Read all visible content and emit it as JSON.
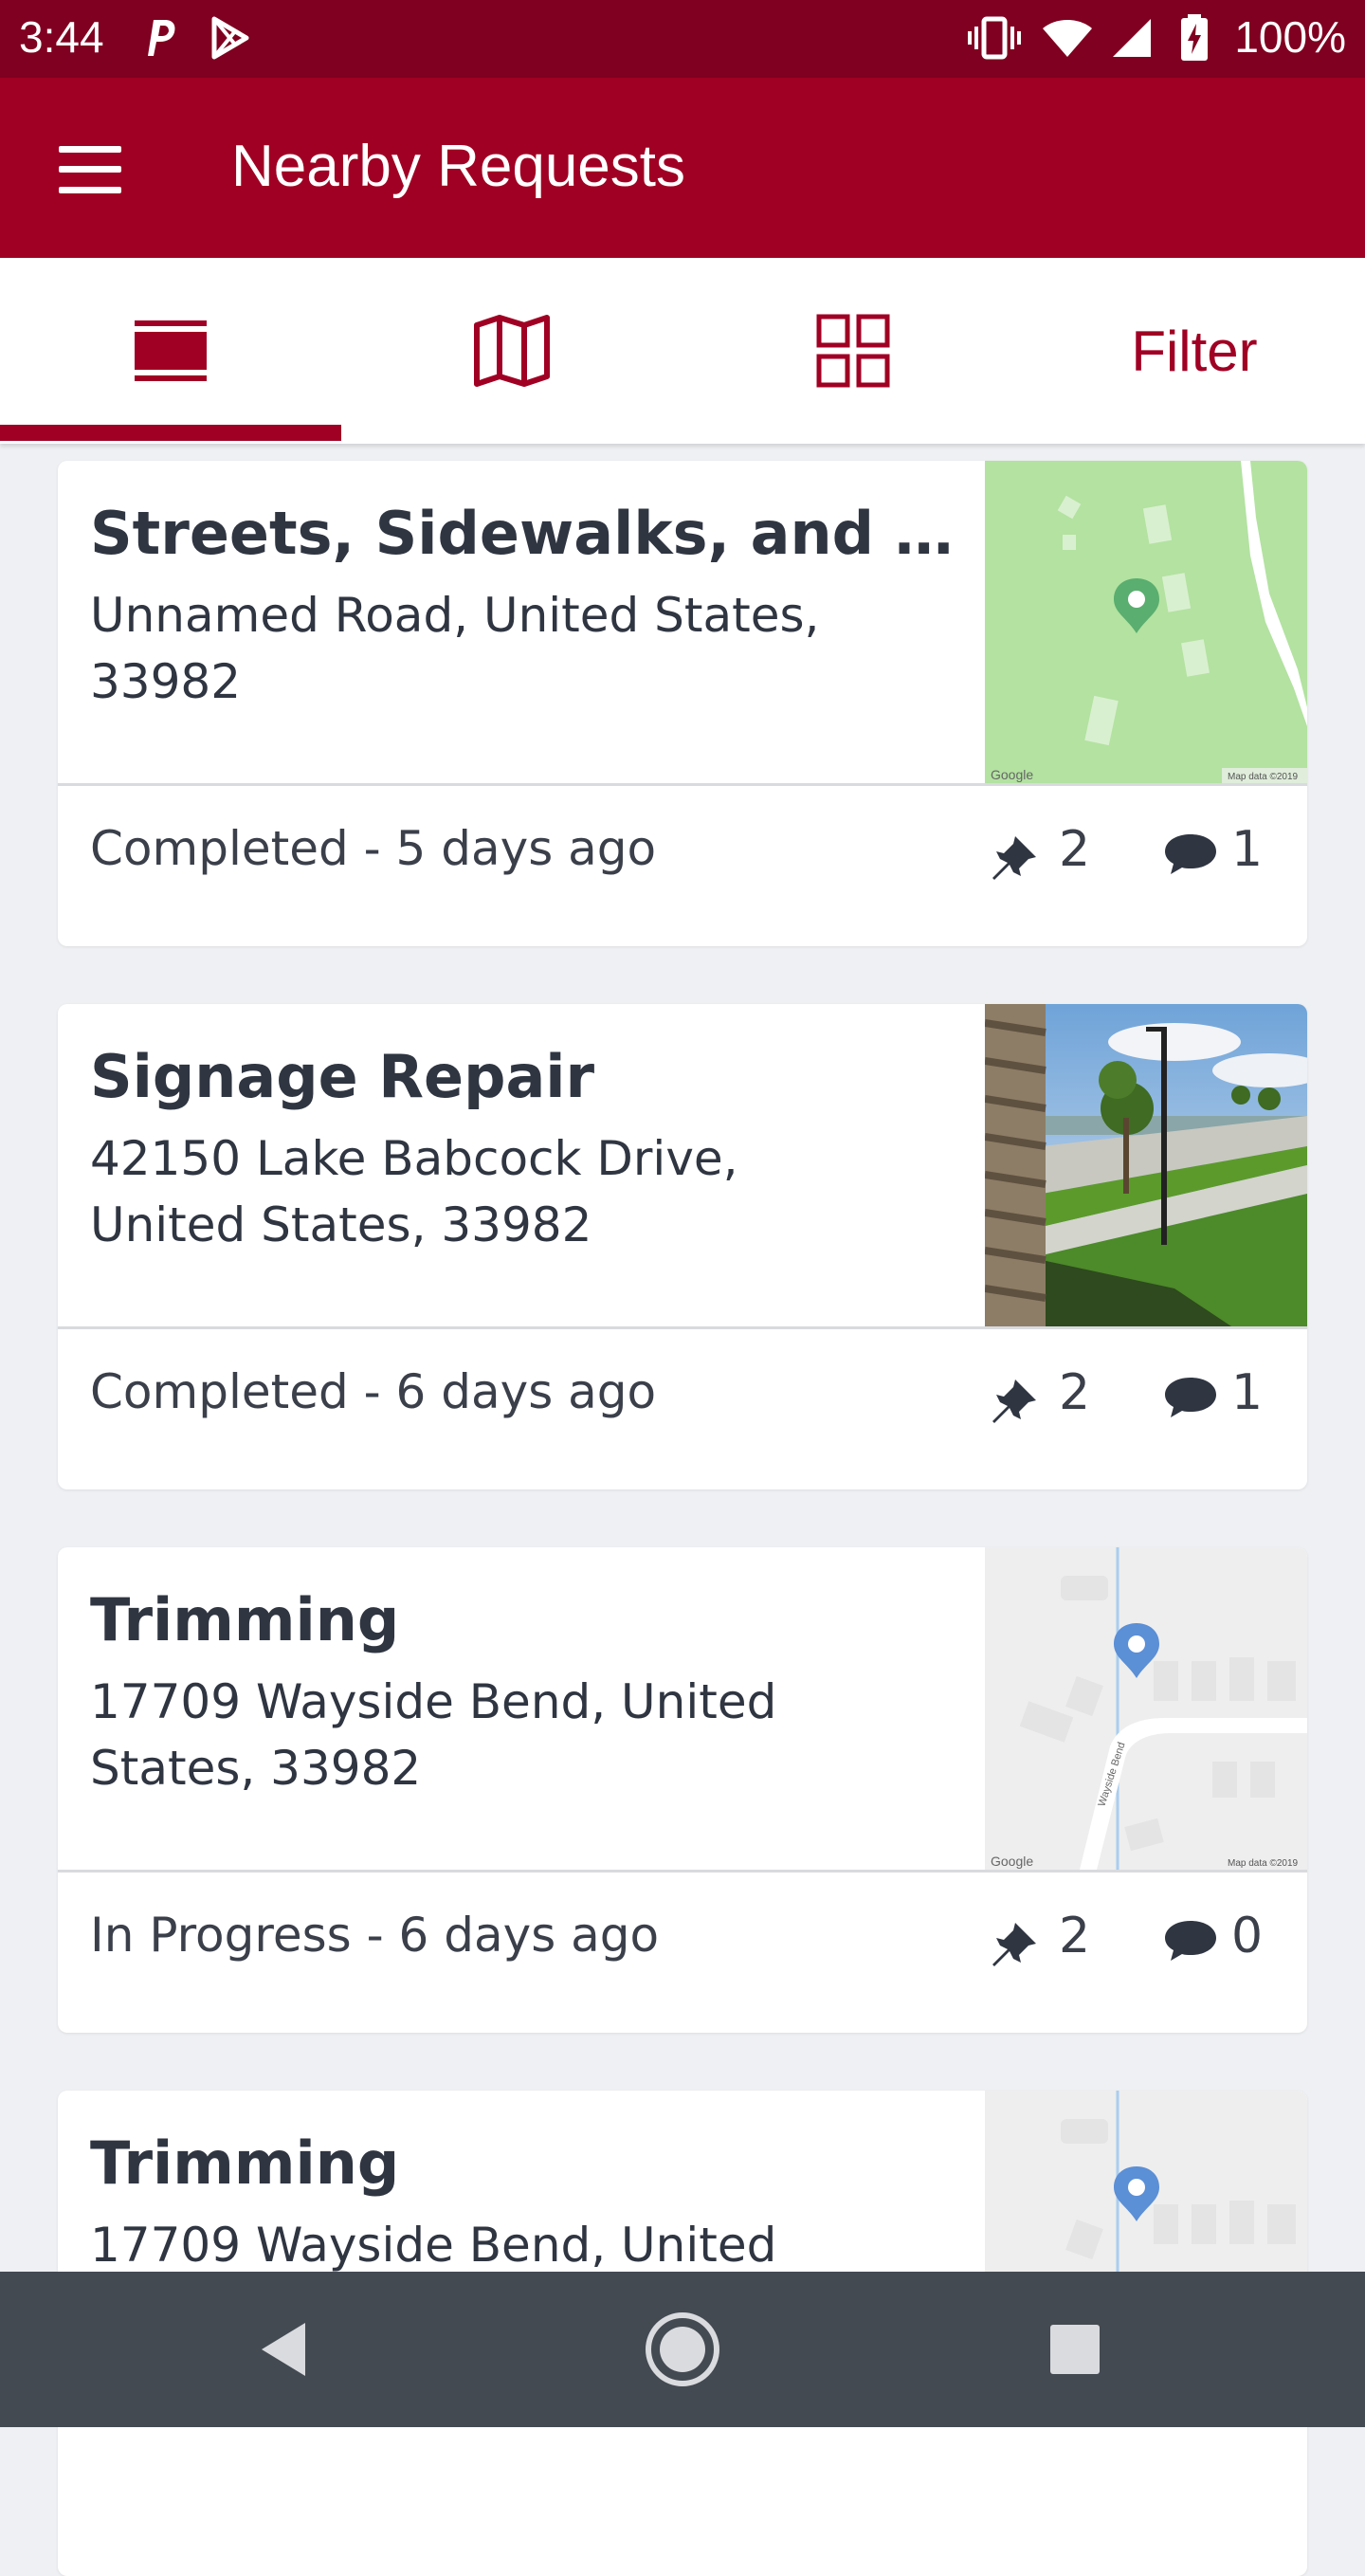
{
  "status_bar": {
    "time": "3:44",
    "battery": "100%",
    "icons": [
      "parking-p-icon",
      "play-store-icon",
      "vibrate-icon",
      "wifi-icon",
      "signal-icon",
      "battery-charging-icon"
    ]
  },
  "app_bar": {
    "title": "Nearby Requests",
    "menu_icon": "hamburger-menu-icon"
  },
  "tabs": [
    {
      "name": "list-view",
      "icon": "list-view-icon",
      "selected": true
    },
    {
      "name": "map-view",
      "icon": "map-icon",
      "selected": false
    },
    {
      "name": "grid-view",
      "icon": "grid-icon",
      "selected": false
    },
    {
      "name": "filter",
      "label": "Filter",
      "selected": false
    }
  ],
  "colors": {
    "primary": "#a00023",
    "status_bar": "#7f0020",
    "background": "#eff0f3",
    "text": "#2f3541",
    "nav_bar": "#444a52"
  },
  "requests": [
    {
      "title": "Streets, Sidewalks, and B...",
      "address": "Unnamed Road, United States, 33982",
      "thumbnail": "map-thumbnail",
      "status": "Completed - 5 days ago",
      "pins": "2",
      "comments": "1"
    },
    {
      "title": "Signage Repair",
      "address": "42150   Lake Babcock Drive, United States, 33982",
      "thumbnail": "photo-thumbnail",
      "status": "Completed - 6 days ago",
      "pins": "2",
      "comments": "1"
    },
    {
      "title": "Trimming",
      "address": "17709   Wayside Bend, United States, 33982",
      "thumbnail": "street-map-thumbnail",
      "status": "In Progress - 6 days ago",
      "pins": "2",
      "comments": "0"
    },
    {
      "title": "Trimming",
      "address": "17709   Wayside Bend, United",
      "thumbnail": "street-map-thumbnail"
    }
  ],
  "map_text": {
    "google": "Google",
    "map_data": "Map data ©2019",
    "street_label": "Wayside Bend"
  },
  "nav_bar": {
    "icons": [
      "back-icon",
      "home-icon",
      "recents-icon"
    ]
  }
}
